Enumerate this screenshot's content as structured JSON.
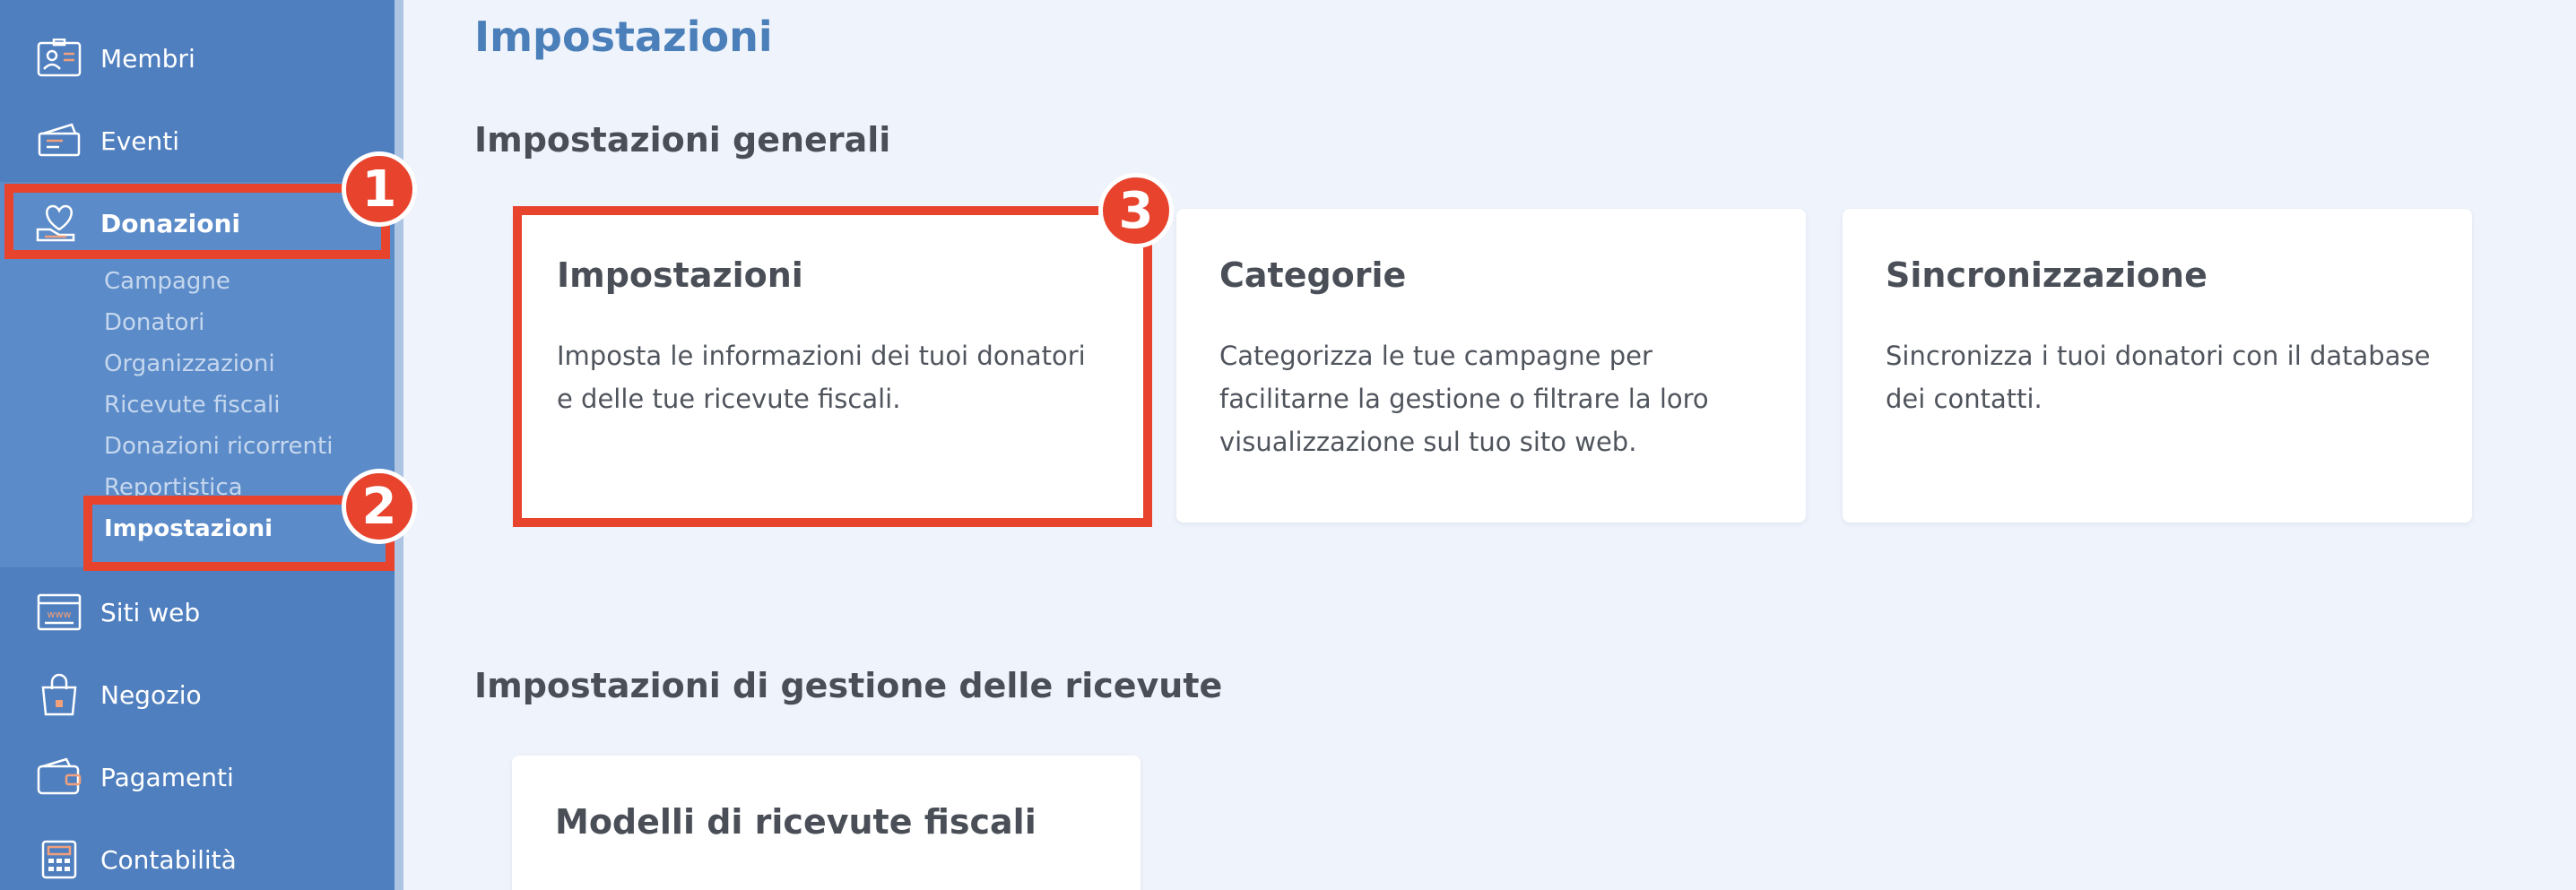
{
  "sidebar": {
    "items": [
      {
        "label": "Membri",
        "icon": "members-icon"
      },
      {
        "label": "Eventi",
        "icon": "tickets-icon"
      },
      {
        "label": "Donazioni",
        "icon": "heart-hand-icon"
      },
      {
        "label": "Siti web",
        "icon": "browser-window-icon"
      },
      {
        "label": "Negozio",
        "icon": "shopping-bag-icon"
      },
      {
        "label": "Pagamenti",
        "icon": "wallet-icon"
      },
      {
        "label": "Contabilità",
        "icon": "calculator-icon"
      }
    ],
    "submenu": [
      {
        "label": "Campagne"
      },
      {
        "label": "Donatori"
      },
      {
        "label": "Organizzazioni"
      },
      {
        "label": "Ricevute fiscali"
      },
      {
        "label": "Donazioni ricorrenti"
      },
      {
        "label": "Reportistica"
      },
      {
        "label": "Impostazioni"
      }
    ]
  },
  "main": {
    "title": "Impostazioni",
    "sections": [
      {
        "title": "Impostazioni generali",
        "cards": [
          {
            "title": "Impostazioni",
            "desc": "Imposta le informazioni dei tuoi donatori e delle tue ricevute fiscali."
          },
          {
            "title": "Categorie",
            "desc": "Categorizza le tue campagne per facilitarne la gestione o filtrare la loro visualizzazione sul tuo sito web."
          },
          {
            "title": "Sincronizzazione",
            "desc": "Sincronizza i tuoi donatori con il database dei contatti."
          }
        ]
      },
      {
        "title": "Impostazioni di gestione delle ricevute",
        "cards": [
          {
            "title": "Modelli di ricevute fiscali"
          }
        ]
      }
    ]
  },
  "annotations": {
    "badges": [
      "1",
      "2",
      "3"
    ],
    "color": "#e8432d"
  },
  "colors": {
    "sidebar": "#4f7fbf",
    "sidebar_active": "#5b8bc8",
    "title": "#4a7fba",
    "background": "#eff3fb"
  }
}
